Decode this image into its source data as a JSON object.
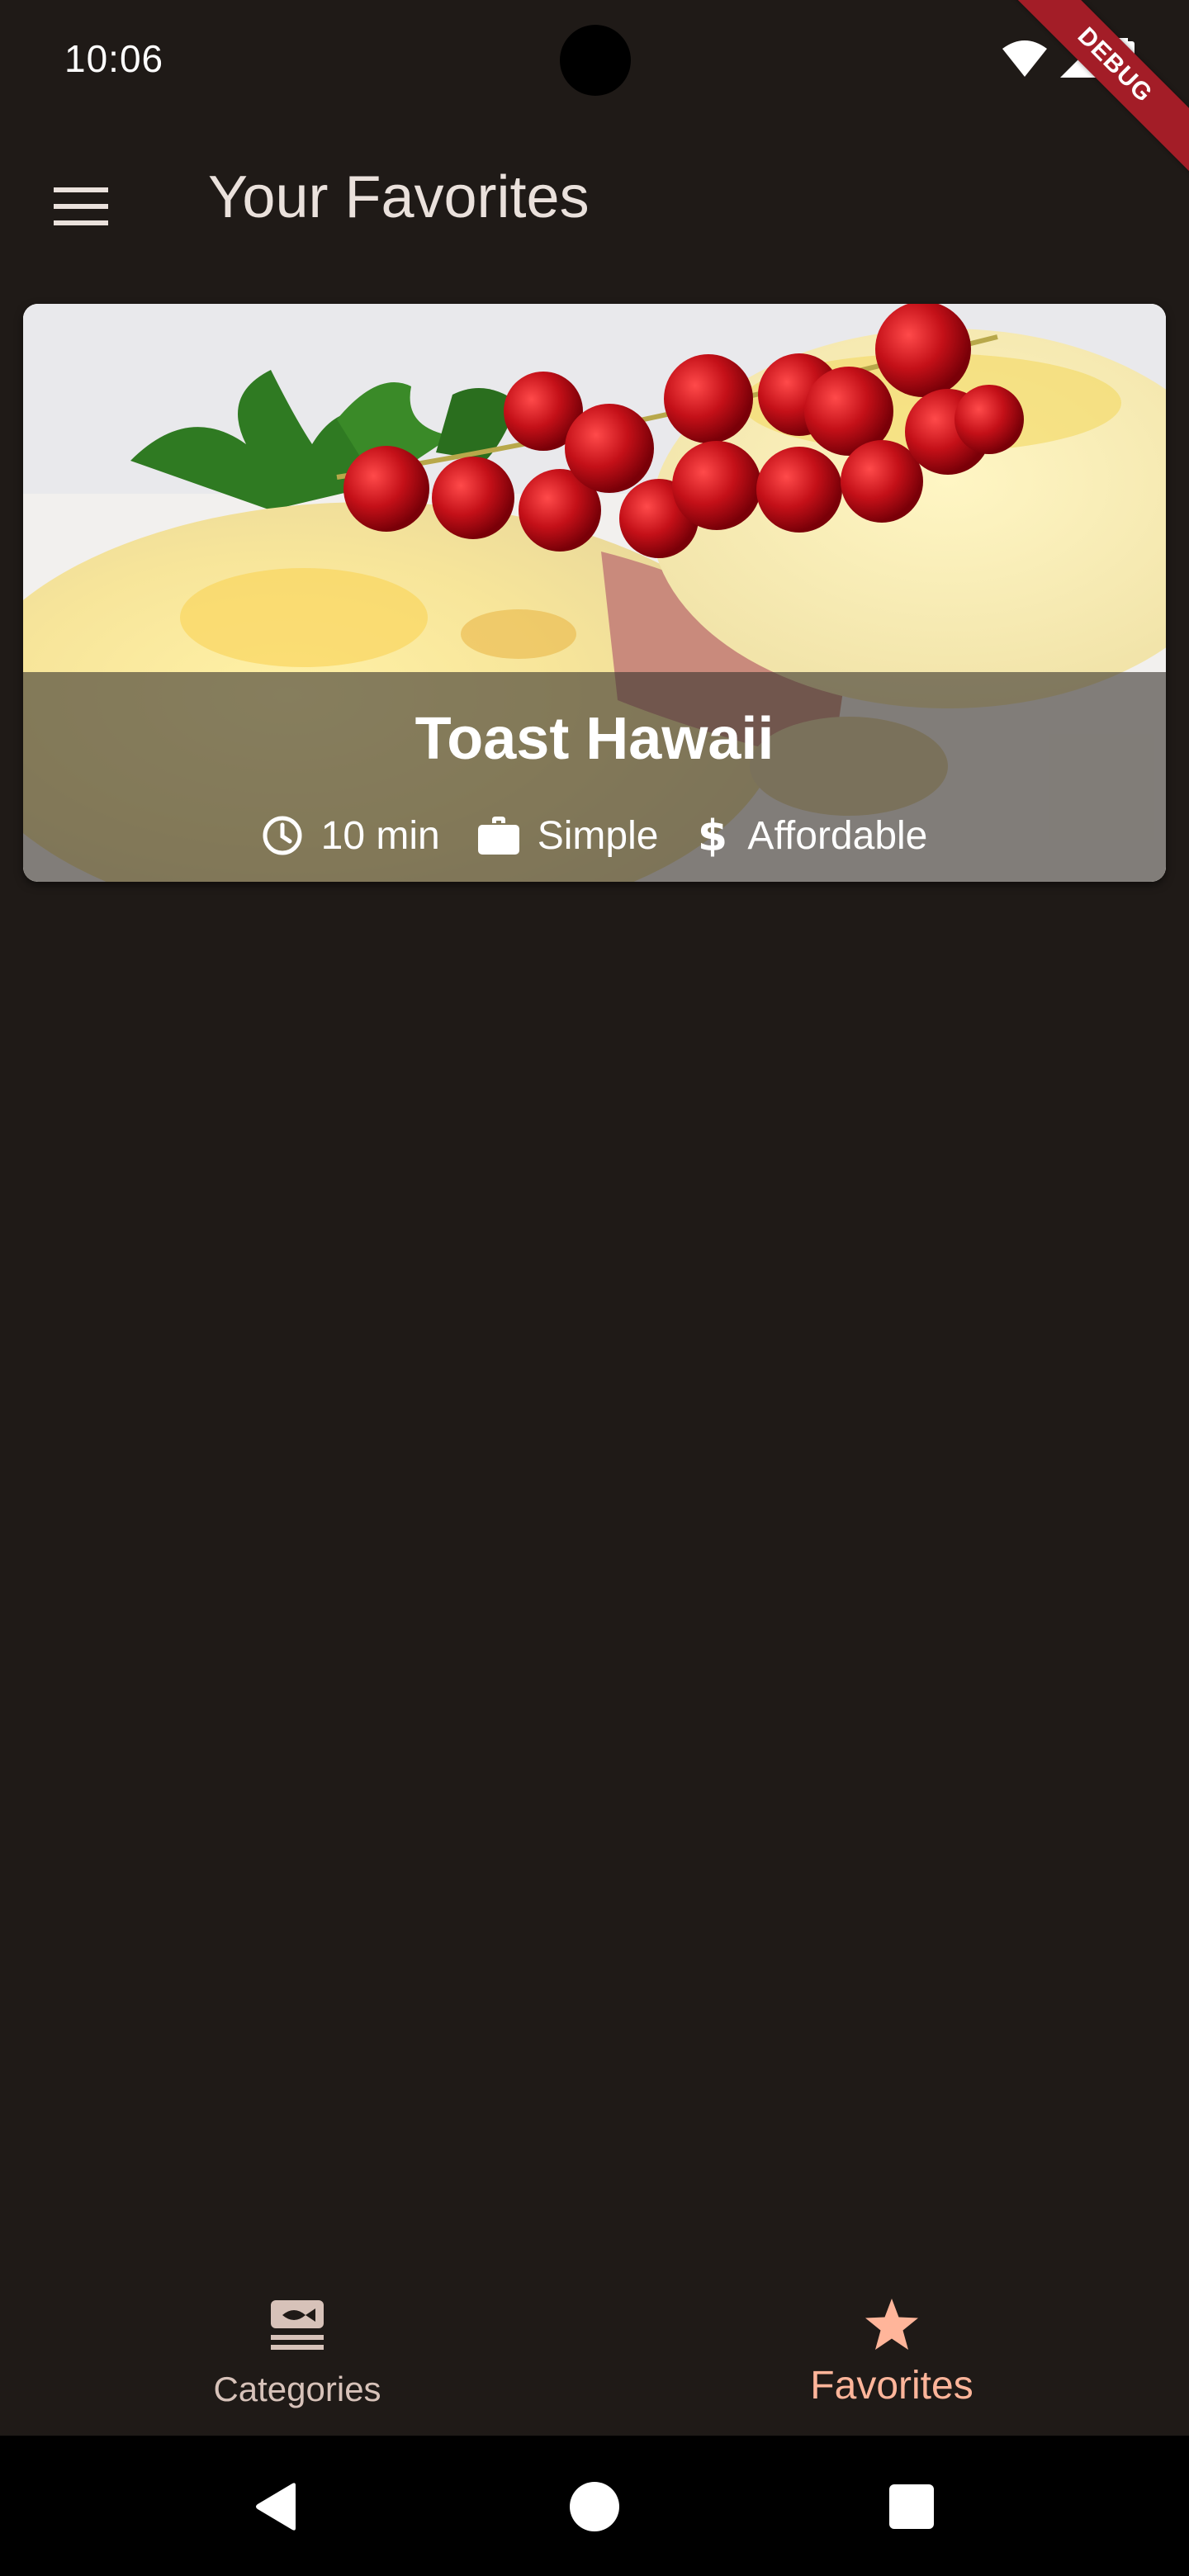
{
  "status_bar": {
    "time": "10:06",
    "debug_label": "DEBUG"
  },
  "app_bar": {
    "title": "Your Favorites"
  },
  "meals": [
    {
      "title": "Toast Hawaii",
      "duration": "10 min",
      "complexity": "Simple",
      "affordability": "Affordable"
    }
  ],
  "bottom_nav": {
    "items": [
      {
        "label": "Categories",
        "icon": "categories-icon",
        "selected": false
      },
      {
        "label": "Favorites",
        "icon": "star-icon",
        "selected": true
      }
    ]
  },
  "colors": {
    "background": "#1f1a17",
    "selected_tab": "#ffb59a",
    "unselected_tab": "#d7c2b9",
    "debug_ribbon": "#a31d27"
  }
}
